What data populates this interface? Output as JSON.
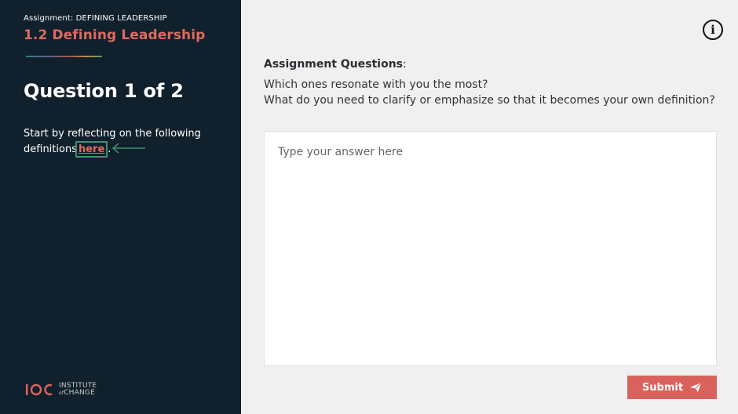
{
  "sidebar": {
    "kicker": "Assignment: DEFINING LEADERSHIP",
    "title": "1.2 Defining Leadership",
    "question_heading": "Question 1 of 2",
    "intro_text": "Start by reflecting on the following definitions",
    "link_text": "here",
    "intro_suffix": ".",
    "logo": {
      "mark": "IOC",
      "line1": "INSTITUTE",
      "line2_of": "of",
      "line2": "CHANGE"
    }
  },
  "main": {
    "section_label": "Assignment Questions",
    "section_colon": ":",
    "question_line1": "Which ones resonate with you the most?",
    "question_line2": "What do you need to clarify or emphasize so that it becomes your own definition?",
    "answer_placeholder": "Type your answer here",
    "answer_value": "",
    "submit_label": "Submit"
  },
  "icons": {
    "info": "info-icon",
    "arrow": "arrow-left-icon",
    "send": "send-icon"
  },
  "colors": {
    "sidebar_bg": "#10202c",
    "accent": "#e06a5e",
    "submit_bg": "#d9635c",
    "highlight_box": "#3f8f75",
    "main_bg": "#f0f0f0"
  }
}
